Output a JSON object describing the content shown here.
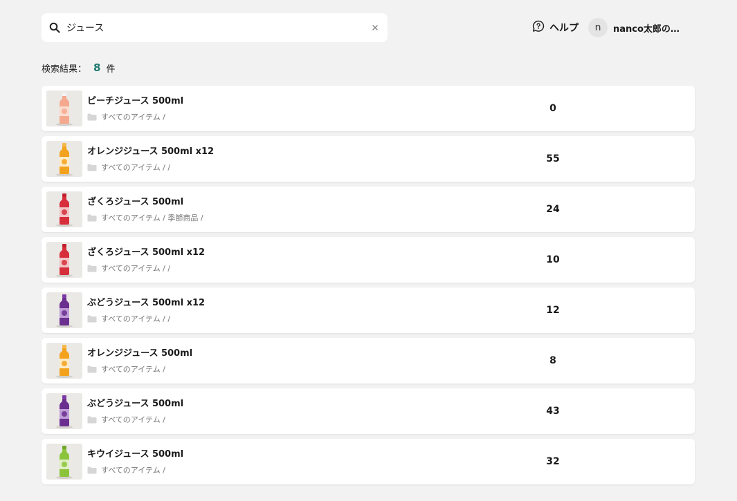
{
  "search": {
    "value": "ジュース",
    "icon": "search-icon"
  },
  "header": {
    "help_label": "ヘルプ",
    "avatar_initial": "n",
    "user_name": "nanco太郎の…"
  },
  "results": {
    "label": "検索結果：",
    "count": "8",
    "unit": "件"
  },
  "items": [
    {
      "name": "ピーチジュース 500ml",
      "path": "すべてのアイテム /",
      "quantity": "0",
      "colors": {
        "liquid": "#f4a98e",
        "cap": "#f3f3f3",
        "label": "#fbe0d4"
      }
    },
    {
      "name": "オレンジジュース 500ml x12",
      "path": "すべてのアイテム /  /",
      "quantity": "55",
      "colors": {
        "liquid": "#f3a21d",
        "cap": "#f5b94a",
        "label": "#fff3dc"
      }
    },
    {
      "name": "ざくろジュース 500ml",
      "path": "すべてのアイテム / 季節商品 /",
      "quantity": "24",
      "colors": {
        "liquid": "#d62f3b",
        "cap": "#c21e2c",
        "label": "#f5d6d6"
      }
    },
    {
      "name": "ざくろジュース 500ml x12",
      "path": "すべてのアイテム /  /",
      "quantity": "10",
      "colors": {
        "liquid": "#d62f3b",
        "cap": "#c21e2c",
        "label": "#f5d6d6"
      }
    },
    {
      "name": "ぶどうジュース 500ml x12",
      "path": "すべてのアイテム /  /",
      "quantity": "12",
      "colors": {
        "liquid": "#6a2f8f",
        "cap": "#7d3aa6",
        "label": "#c9a9df"
      }
    },
    {
      "name": "オレンジジュース 500ml",
      "path": "すべてのアイテム /",
      "quantity": "8",
      "colors": {
        "liquid": "#f3a21d",
        "cap": "#f5b94a",
        "label": "#fff3dc"
      }
    },
    {
      "name": "ぶどうジュース 500ml",
      "path": "すべてのアイテム /",
      "quantity": "43",
      "colors": {
        "liquid": "#6a2f8f",
        "cap": "#7d3aa6",
        "label": "#c9a9df"
      }
    },
    {
      "name": "キウイジュース 500ml",
      "path": "すべてのアイテム /",
      "quantity": "32",
      "colors": {
        "liquid": "#8bc33a",
        "cap": "#6ea62a",
        "label": "#e7f3d2"
      }
    }
  ]
}
